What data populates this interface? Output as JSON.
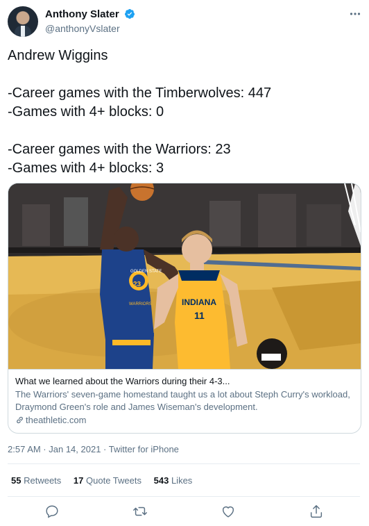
{
  "author": {
    "display_name": "Anthony Slater",
    "handle": "@anthonyVslater",
    "verified": true
  },
  "tweet_text": "Andrew Wiggins\n\n-Career games with the Timberwolves: 447\n-Games with 4+ blocks: 0\n\n-Career games with the Warriors: 23\n-Games with 4+ blocks: 3",
  "card": {
    "title": "What we learned about the Warriors during their 4-3...",
    "description": "The Warriors' seven-game homestand taught us a lot about Steph Curry's workload, Draymond Green's role and James Wiseman's development.",
    "domain": "theathletic.com",
    "image_jersey_left": [
      "GOLDEN STATE",
      "23",
      "WARRIORS"
    ],
    "image_jersey_right": [
      "INDIANA",
      "11"
    ]
  },
  "meta": {
    "timestamp": "2:57 AM · Jan 14, 2021 · Twitter for iPhone"
  },
  "stats": {
    "retweets_count": "55",
    "retweets_label": "Retweets",
    "quotes_count": "17",
    "quotes_label": "Quote Tweets",
    "likes_count": "543",
    "likes_label": "Likes"
  },
  "colors": {
    "verified_blue": "#1da1f2",
    "secondary_text": "#5b7083",
    "border": "#cfd9de"
  },
  "icons": [
    "verified-badge-icon",
    "more-icon",
    "link-icon",
    "reply-icon",
    "retweet-icon",
    "like-icon",
    "share-icon"
  ]
}
